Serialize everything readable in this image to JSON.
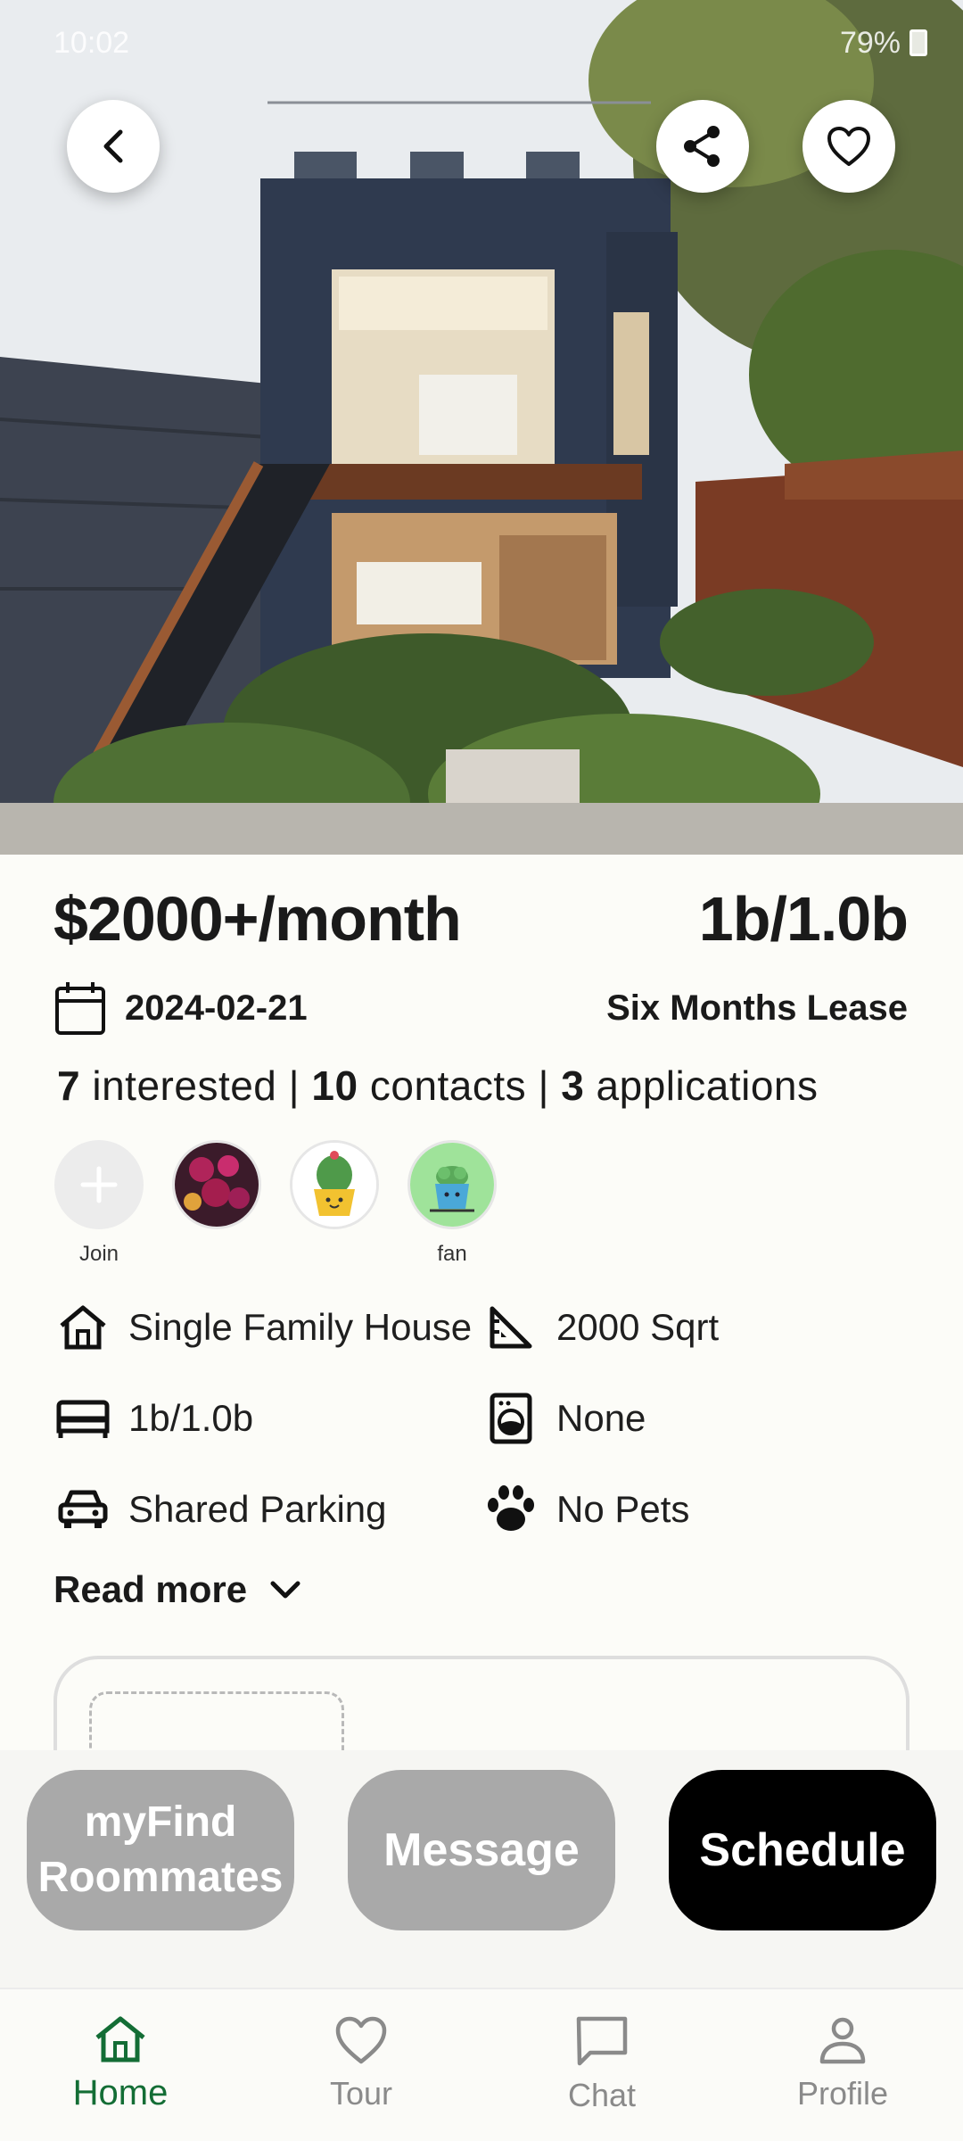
{
  "status_bar": {
    "time": "10:02",
    "battery": "79%"
  },
  "listing": {
    "price": "$2000+/month",
    "beds_baths": "1b/1.0b",
    "date": "2024-02-21",
    "lease": "Six Months Lease",
    "stats": {
      "interested_count": "7",
      "interested_label": " interested | ",
      "contacts_count": "10",
      "contacts_label": " contacts | ",
      "applications_count": "3",
      "applications_label": " applications"
    }
  },
  "avatars": [
    {
      "label": "Join",
      "icon": "plus-icon"
    },
    {
      "label": "",
      "icon": "flower-photo"
    },
    {
      "label": "",
      "icon": "cactus-illustration"
    },
    {
      "label": "fan",
      "icon": "succulent-illustration"
    }
  ],
  "features": {
    "type": "Single Family House",
    "area": "2000 Sqrt",
    "beds": "1b/1.0b",
    "laundry": "None",
    "parking": "Shared Parking",
    "pets": "No Pets"
  },
  "read_more": "Read more",
  "actions": {
    "roommates_line1": "myFind",
    "roommates_line2": "Roommates",
    "message": "Message",
    "schedule": "Schedule"
  },
  "nav": {
    "home": "Home",
    "tour": "Tour",
    "chat": "Chat",
    "profile": "Profile"
  },
  "colors": {
    "accent_green": "#136d35",
    "button_gray": "#a9a9a9",
    "button_black": "#000000"
  }
}
